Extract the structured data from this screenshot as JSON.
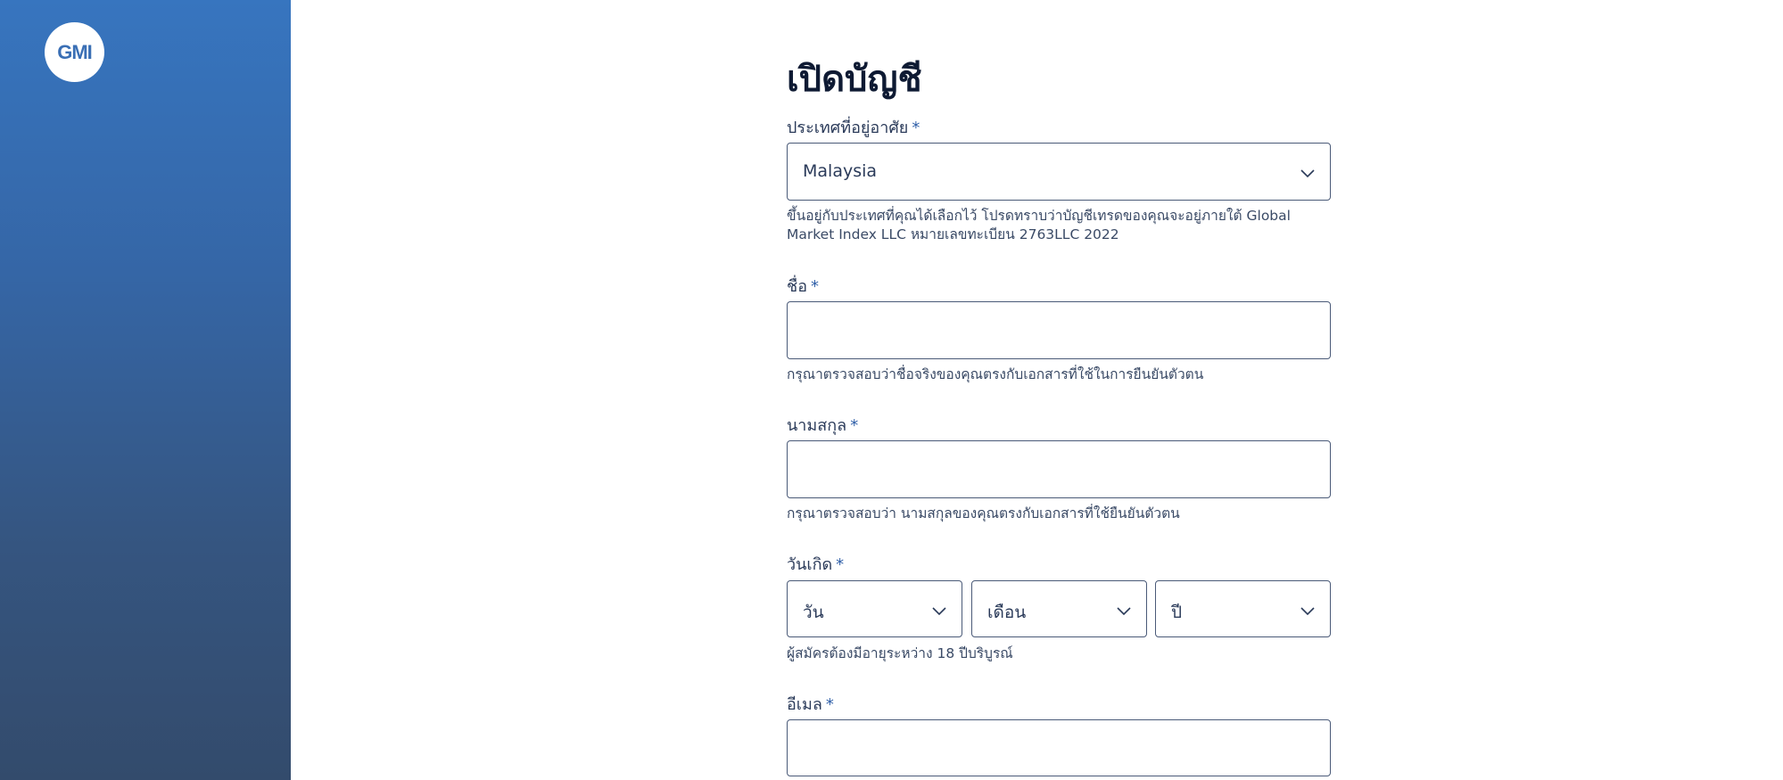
{
  "brand": {
    "logo_text": "GMI"
  },
  "form": {
    "title": "เปิดบัญชี",
    "required_mark": "*",
    "country": {
      "label": "ประเทศที่อยู่อาศัย",
      "value": "Malaysia",
      "help": "ขึ้นอยู่กับประเทศที่คุณได้เลือกไว้ โปรดทราบว่าบัญชีเทรดของคุณจะอยู่ภายใต้ Global Market Index LLC หมายเลขทะเบียน 2763LLC 2022"
    },
    "first_name": {
      "label": "ชื่อ",
      "value": "",
      "help": "กรุณาตรวจสอบว่าชื่อจริงของคุณตรงกับเอกสารที่ใช้ในการยืนยันตัวตน"
    },
    "last_name": {
      "label": "นามสกุล",
      "value": "",
      "help": "กรุณาตรวจสอบว่า นามสกุลของคุณตรงกับเอกสารที่ใช้ยืนยันตัวตน"
    },
    "birthdate": {
      "label": "วันเกิด",
      "day": "วัน",
      "month": "เดือน",
      "year": "ปี",
      "help": "ผู้สมัครต้องมีอายุระหว่าง 18 ปีบริบูรณ์"
    },
    "email": {
      "label": "อีเมล",
      "value": ""
    }
  },
  "colors": {
    "sidebar_top": "#3775bf",
    "sidebar_bottom": "#334b6c",
    "accent": "#2f5fa8",
    "border": "#4a5a78"
  }
}
